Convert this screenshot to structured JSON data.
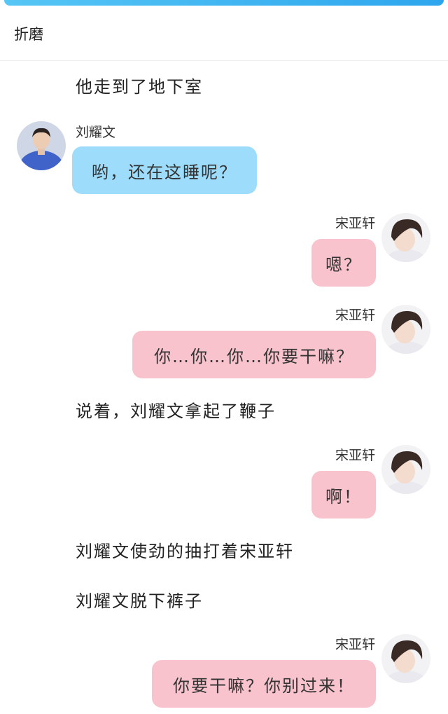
{
  "header": {
    "title": "折磨"
  },
  "messages": [
    {
      "kind": "narration",
      "text": "他走到了地下室"
    },
    {
      "kind": "left",
      "name": "刘耀文",
      "text": "哟，还在这睡呢？"
    },
    {
      "kind": "right",
      "name": "宋亚轩",
      "text": "嗯？"
    },
    {
      "kind": "right",
      "name": "宋亚轩",
      "text": "你…你…你…你要干嘛？"
    },
    {
      "kind": "narration",
      "text": "说着，刘耀文拿起了鞭子"
    },
    {
      "kind": "right",
      "name": "宋亚轩",
      "text": "啊！"
    },
    {
      "kind": "narration",
      "text": "刘耀文使劲的抽打着宋亚轩"
    },
    {
      "kind": "narration",
      "text": "刘耀文脱下裤子"
    },
    {
      "kind": "right",
      "name": "宋亚轩",
      "text": "你要干嘛？你别过来！"
    }
  ],
  "colors": {
    "accent": "#2ea6ee",
    "left_bubble": "#9ddcfb",
    "right_bubble": "#f8c3cd"
  },
  "icons": {
    "left_avatar": "avatar-blue-shirt-icon",
    "right_avatar": "avatar-dark-hair-icon"
  }
}
